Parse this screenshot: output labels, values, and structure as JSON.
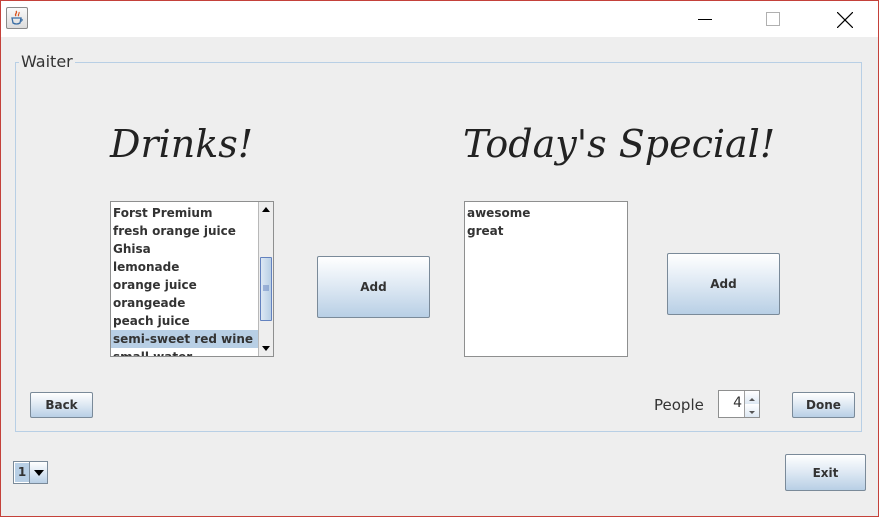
{
  "window": {
    "group_title": "Waiter"
  },
  "icons": {
    "app": "java-coffee-icon",
    "minimize": "minimize-icon",
    "maximize": "maximize-icon",
    "close": "close-icon"
  },
  "drinks": {
    "heading": "Drinks!",
    "items": [
      "Forst Premium",
      "fresh orange juice",
      "Ghisa",
      "lemonade",
      "orange juice",
      "orangeade",
      "peach juice",
      "semi-sweet red wine",
      "small water"
    ],
    "selected": "semi-sweet red wine",
    "add_label": "Add"
  },
  "specials": {
    "heading": "Today's Special!",
    "items": [
      "awesome",
      "great"
    ],
    "add_label": "Add"
  },
  "footer": {
    "back_label": "Back",
    "people_label": "People",
    "people_value": "4",
    "done_label": "Done",
    "table_select": "1",
    "exit_label": "Exit"
  },
  "colors": {
    "accent": "#b8cfe5",
    "window_border": "#c4413a",
    "background": "#eeeeee"
  }
}
